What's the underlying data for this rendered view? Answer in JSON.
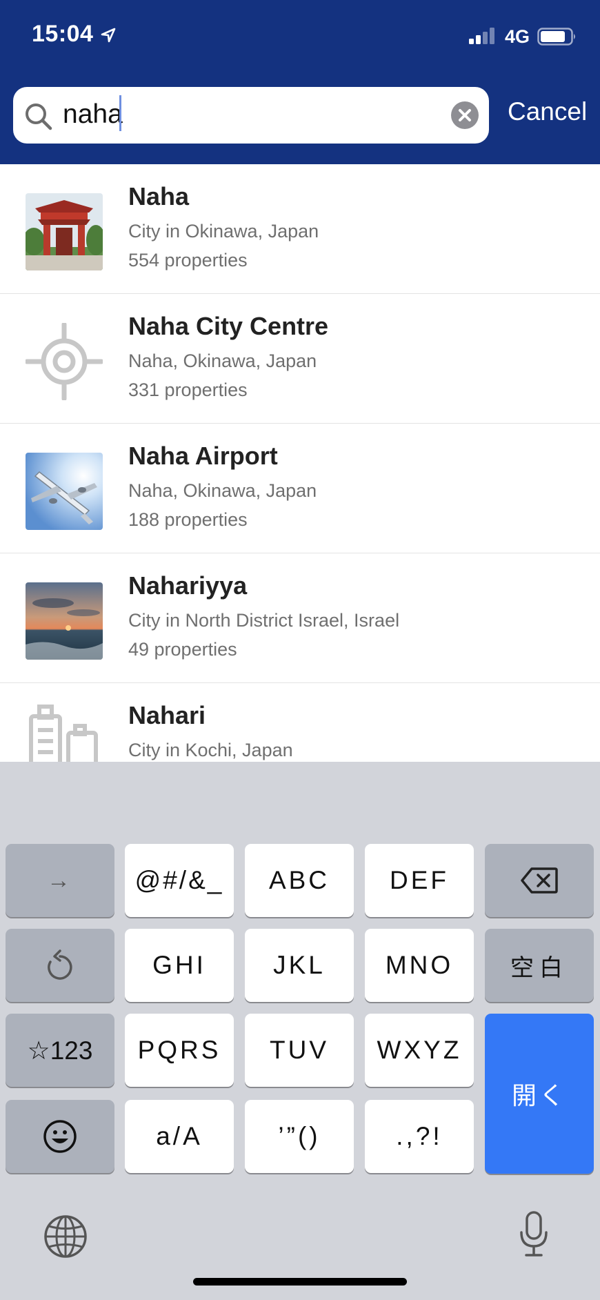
{
  "status_bar": {
    "time": "15:04",
    "network": "4G"
  },
  "search": {
    "query": "naha",
    "cancel_label": "Cancel"
  },
  "results": [
    {
      "title": "Naha",
      "subtitle": "City in Okinawa, Japan",
      "count": "554 properties",
      "thumb": "shrine-gate-photo"
    },
    {
      "title": "Naha City Centre",
      "subtitle": "Naha, Okinawa, Japan",
      "count": "331 properties",
      "thumb": "target-icon"
    },
    {
      "title": "Naha Airport",
      "subtitle": "Naha, Okinawa, Japan",
      "count": "188 properties",
      "thumb": "airplane-photo"
    },
    {
      "title": "Nahariyya",
      "subtitle": "City in North District Israel, Israel",
      "count": "49 properties",
      "thumb": "sunset-sea-photo"
    },
    {
      "title": "Nahari",
      "subtitle": "City in Kochi, Japan",
      "count": "",
      "thumb": "city-buildings-icon"
    }
  ],
  "keyboard": {
    "row1": [
      "→",
      "@#/&_",
      "ABC",
      "DEF",
      "⌫"
    ],
    "row2": [
      "↺",
      "GHI",
      "JKL",
      "MNO",
      "空白"
    ],
    "row3": [
      "☆123",
      "PQRS",
      "TUV",
      "WXYZ"
    ],
    "row4": [
      "☺",
      "a/A",
      "’”()",
      ".,?!"
    ],
    "go_label": "開く"
  },
  "colors": {
    "header": "#143280",
    "go_key": "#3478f6",
    "keyboard_bg": "#d2d4da"
  }
}
